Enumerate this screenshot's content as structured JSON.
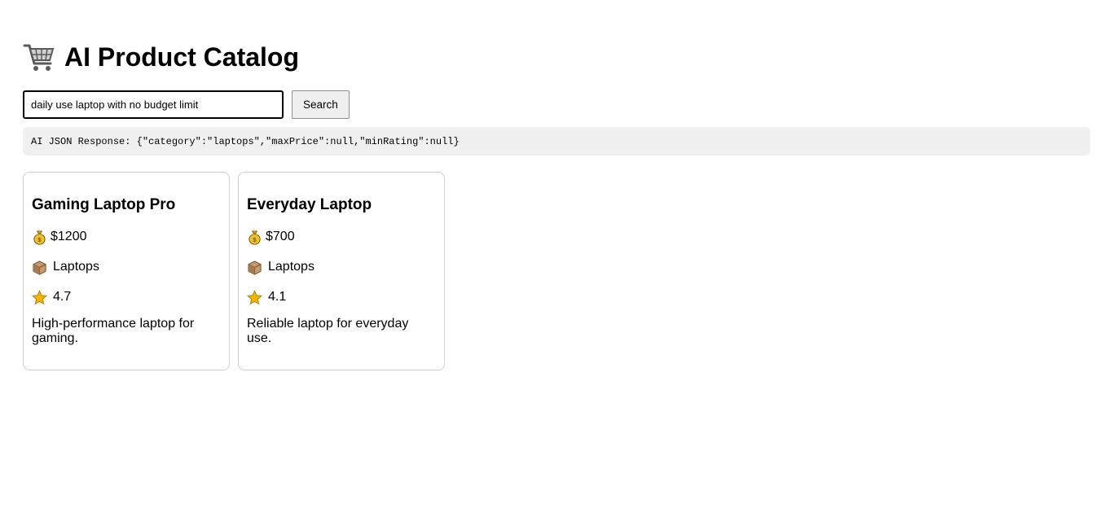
{
  "header": {
    "title": "AI Product Catalog",
    "icon": "shopping-cart-icon"
  },
  "search": {
    "value": "daily use laptop with no budget limit",
    "button_label": "Search"
  },
  "ai_response": {
    "text": "AI JSON Response: {\"category\":\"laptops\",\"maxPrice\":null,\"minRating\":null}"
  },
  "products": [
    {
      "name": "Gaming Laptop Pro",
      "price": "$1200",
      "category": "Laptops",
      "rating": "4.7",
      "description": "High-performance laptop for gaming."
    },
    {
      "name": "Everyday Laptop",
      "price": "$700",
      "category": "Laptops",
      "rating": "4.1",
      "description": "Reliable laptop for everyday use."
    }
  ],
  "icons": {
    "price": "money-bag-icon",
    "category": "package-icon",
    "rating": "star-icon"
  },
  "colors": {
    "json_box_bg": "#f0f0f0",
    "card_border": "#cfcfcf",
    "star": "#f4b400"
  }
}
